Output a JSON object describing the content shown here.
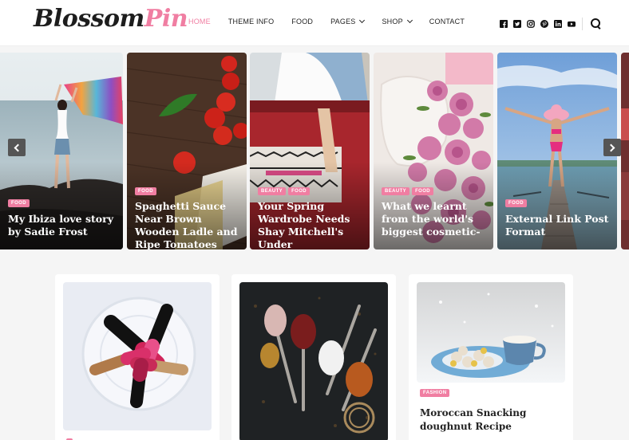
{
  "brand": {
    "name_part1": "Blossom",
    "name_part2": "Pin",
    "accent_color": "#f07ea2"
  },
  "nav": {
    "items": [
      {
        "label": "HOME",
        "active": true,
        "has_dropdown": false
      },
      {
        "label": "THEME INFO",
        "active": false,
        "has_dropdown": false
      },
      {
        "label": "FOOD",
        "active": false,
        "has_dropdown": false
      },
      {
        "label": "PAGES",
        "active": false,
        "has_dropdown": true
      },
      {
        "label": "SHOP",
        "active": false,
        "has_dropdown": true
      },
      {
        "label": "CONTACT",
        "active": false,
        "has_dropdown": false
      }
    ]
  },
  "social": {
    "icons": [
      "facebook-icon",
      "twitter-icon",
      "instagram-icon",
      "pinterest-icon",
      "linkedin-icon",
      "youtube-icon"
    ]
  },
  "slider": {
    "slides": [
      {
        "tags": [
          "FOOD"
        ],
        "title": "My Ibiza love story by Sadie Frost"
      },
      {
        "tags": [
          "FOOD"
        ],
        "title": "Spaghetti Sauce Near Brown Wooden Ladle and Ripe Tomatoes"
      },
      {
        "tags": [
          "BEAUTY",
          "FOOD"
        ],
        "title": "Your Spring Wardrobe Needs Shay Mitchell's Under"
      },
      {
        "tags": [
          "BEAUTY",
          "FOOD"
        ],
        "title": "What we learnt from the world's biggest cosmetic-"
      },
      {
        "tags": [
          "FOOD"
        ],
        "title": "External Link Post Format"
      }
    ]
  },
  "cards": [
    {
      "image": "nail-polish-bottles",
      "tag": "",
      "title": ""
    },
    {
      "image": "spices-on-spoons",
      "tag": "",
      "title": ""
    },
    {
      "image": "snacks-and-cup",
      "tag": "FASHION",
      "title": "Moroccan Snacking doughnut Recipe"
    }
  ]
}
